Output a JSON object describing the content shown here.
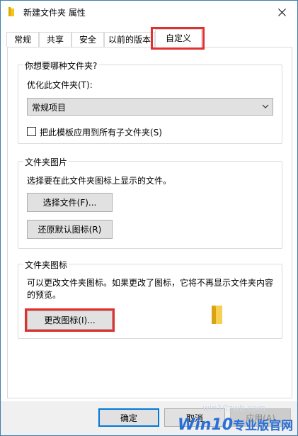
{
  "window": {
    "title": "新建文件夹 属性"
  },
  "tabs": [
    "常规",
    "共享",
    "安全",
    "以前的版本",
    "自定义"
  ],
  "active_tab": "自定义",
  "optimize_group": {
    "legend": "你想要哪种文件夹?",
    "label": "优化此文件夹(T):",
    "selected": "常规项目",
    "checkbox_label": "把此模板应用到所有子文件夹(S)",
    "checked": false
  },
  "picture_group": {
    "legend": "文件夹图片",
    "description": "选择要在此文件夹图标上显示的文件。",
    "choose_button": "选择文件(F)...",
    "restore_button": "还原默认图标(R)"
  },
  "icon_group": {
    "legend": "文件夹图标",
    "description_line1": "可以更改文件夹图标。如果更改了图标，它将不再显示文件夹内容",
    "description_line2": "的预览。",
    "change_button": "更改图标(I)..."
  },
  "buttons": {
    "ok": "确定",
    "cancel": "取消",
    "apply": "应用(A)"
  },
  "watermark": {
    "url": "win10zwb.com",
    "brand": "Win10",
    "suffix": "专业版官网"
  },
  "colors": {
    "highlight": "#e03030",
    "folder": "#f5c518",
    "accent": "#0078d7"
  }
}
